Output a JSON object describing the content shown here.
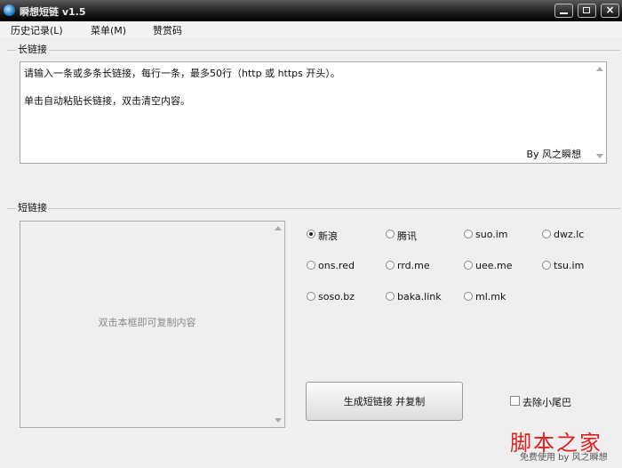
{
  "window": {
    "title": "瞬想短链 v1.5",
    "close_glyph": "×"
  },
  "menu": {
    "items": [
      "历史记录(L)",
      "菜单(M)",
      "赞赏码"
    ]
  },
  "long_link": {
    "label": "长链接",
    "line1": "请输入一条或多条长链接，每行一条，最多50行（http 或 https 开头）。",
    "line2": "单击自动粘贴长链接，双击清空内容。",
    "signature": "By 风之瞬想"
  },
  "short_link": {
    "label": "短链接",
    "hint": "双击本框即可复制内容"
  },
  "services": [
    {
      "label": "新浪",
      "selected": true
    },
    {
      "label": "腾讯",
      "selected": false
    },
    {
      "label": "suo.im",
      "selected": false
    },
    {
      "label": "dwz.lc",
      "selected": false
    },
    {
      "label": "ons.red",
      "selected": false
    },
    {
      "label": "rrd.me",
      "selected": false
    },
    {
      "label": "uee.me",
      "selected": false
    },
    {
      "label": "tsu.im",
      "selected": false
    },
    {
      "label": "soso.bz",
      "selected": false
    },
    {
      "label": "baka.link",
      "selected": false
    },
    {
      "label": "ml.mk",
      "selected": false
    }
  ],
  "generate_button": {
    "label": "生成短链接 并复制"
  },
  "remove_tail": {
    "label": "去除小尾巴",
    "checked": false
  },
  "watermark": {
    "logo": "脚本之家",
    "line": "免费使用 by 风之瞬想"
  }
}
